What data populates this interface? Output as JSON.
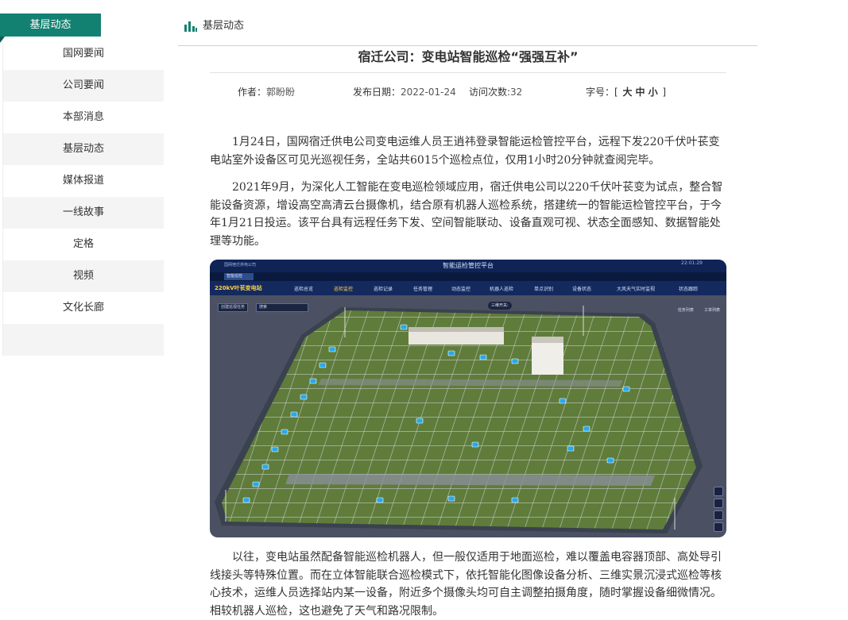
{
  "sidebar": {
    "header": "基层动态",
    "items": [
      {
        "label": "国网要闻"
      },
      {
        "label": "公司要闻"
      },
      {
        "label": "本部消息"
      },
      {
        "label": "基层动态"
      },
      {
        "label": "媒体报道"
      },
      {
        "label": "一线故事"
      },
      {
        "label": "定格"
      },
      {
        "label": "视频"
      },
      {
        "label": "文化长廊"
      }
    ]
  },
  "breadcrumb": {
    "label": "基层动态",
    "icon": "bar-chart-icon"
  },
  "article": {
    "title": "宿迁公司：变电站智能巡检“强强互补”",
    "meta": {
      "author_label": "作者：",
      "author": "郭盼盼",
      "date_label": "发布日期：",
      "date": "2022-01-24",
      "visits_label": "访问次数:",
      "visits": "32",
      "fontsize_label": "字号：",
      "fontsize_open": "[",
      "fontsize_large": "大",
      "fontsize_medium": "中",
      "fontsize_small": "小",
      "fontsize_close": "]"
    },
    "paragraphs": [
      "1月24日，国网宿迁供电公司变电运维人员王逍祎登录智能运检管控平台，远程下发220千伏叶苌变电站室外设备区可见光巡视任务，全站共6015个巡检点位，仅用1小时20分钟就查阅完毕。",
      "2021年9月，为深化人工智能在变电巡检领域应用，宿迁供电公司以220千伏叶苌变为试点，整合智能设备资源，增设高空高清云台摄像机，结合原有机器人巡检系统，搭建统一的智能运检管控平台，于今年1月21日投运。该平台具有远程任务下发、空间智能联动、设备直观可视、状态全面感知、数据智能处理等功能。",
      "以往，变电站虽然配备智能巡检机器人，但一般仅适用于地面巡检，难以覆盖电容器顶部、高处导引线接头等特殊位置。而在立体智能联合巡检模式下，依托智能化图像设备分析、三维实景沉浸式巡检等核心技术，运维人员选择站内某一设备，附近多个摄像头均可自主调整拍摄角度，随时掌握设备细微情况。相较机器人巡检，这也避免了天气和路况限制。"
    ]
  },
  "figure": {
    "app_title": "智能运检管控平台",
    "company": "国网宿迁供电公司",
    "time": "22:01:29",
    "tab": "智能巡检",
    "site": "220kV叶苌变电站",
    "nav": [
      "巡检总览",
      "巡检监控",
      "巡检记录",
      "任务管理",
      "动态监控",
      "机器人巡检",
      "单点识别",
      "设备状态",
      "大风天气实时监视",
      "状态跟踪"
    ],
    "create_button": "创建巡视任务",
    "search_button": "搜索",
    "toggle_label": "三维开关:",
    "right_tabs": [
      "任务列表",
      "工单列表"
    ]
  },
  "colors": {
    "brand_green": "#138171",
    "figure_header": "#0f2356",
    "figure_ground": "#5d7a3a"
  }
}
